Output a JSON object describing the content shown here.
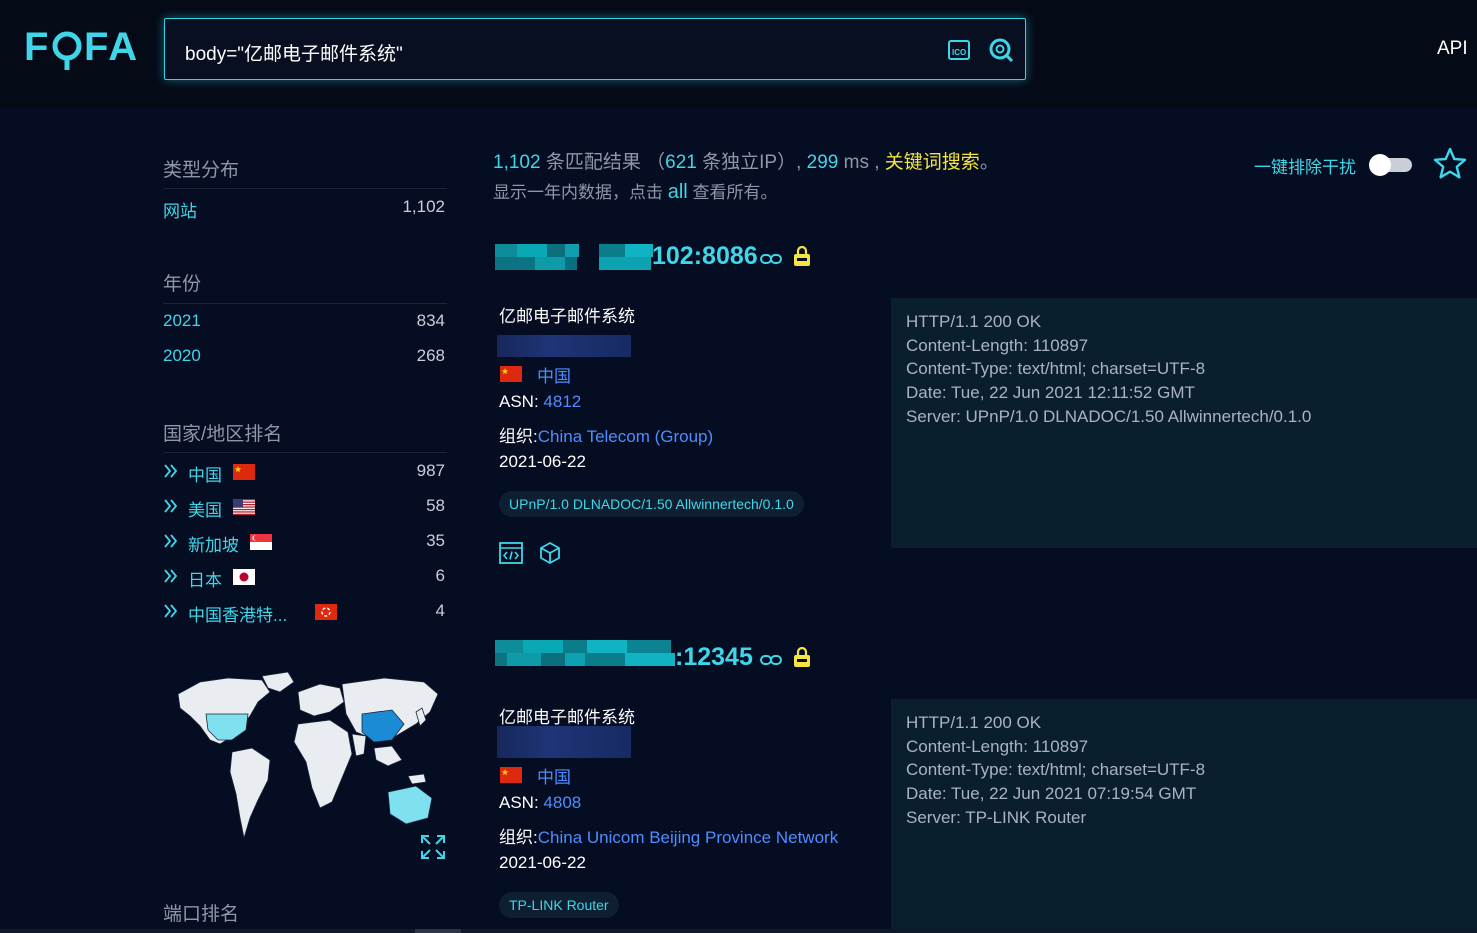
{
  "brand": {
    "logo_text": "FOFA"
  },
  "search": {
    "query": "body=\"亿邮电子邮件系统\"",
    "icons": [
      "ico-search-icon",
      "image-search-icon"
    ]
  },
  "header": {
    "api_label": "API"
  },
  "sidebar": {
    "type_section": {
      "title": "类型分布",
      "rows": [
        {
          "label": "网站",
          "count": "1,102"
        }
      ]
    },
    "year_section": {
      "title": "年份",
      "rows": [
        {
          "label": "2021",
          "count": "834"
        },
        {
          "label": "2020",
          "count": "268"
        }
      ]
    },
    "country_section": {
      "title": "国家/地区排名",
      "rows": [
        {
          "label": "中国",
          "count": "987",
          "flag": "cn-flag"
        },
        {
          "label": "美国",
          "count": "58",
          "flag": "us-flag"
        },
        {
          "label": "新加坡",
          "count": "35",
          "flag": "sg-flag"
        },
        {
          "label": "日本",
          "count": "6",
          "flag": "jp-flag"
        },
        {
          "label": "中国香港特...",
          "count": "4",
          "flag": "hk-flag"
        }
      ]
    },
    "port_section": {
      "title": "端口排名"
    }
  },
  "summary": {
    "total": "1,102",
    "total_suffix": "条匹配结果",
    "paren_open": "（",
    "unique_ip": "621",
    "unique_ip_suffix": "条独立IP）,",
    "time": "299",
    "time_unit": "ms ,",
    "mode": "关键词搜索",
    "mode_end": "。",
    "line2_prefix": "显示一年内数据，点击",
    "line2_link": "all",
    "line2_suffix": "查看所有。"
  },
  "controls": {
    "toggle_label": "一键排除干扰",
    "toggle_on": false
  },
  "results": [
    {
      "host_visible": "102:8086",
      "title": "亿邮电子邮件系统",
      "country": "中国",
      "asn_label": "ASN:",
      "asn": "4812",
      "org_label": "组织:",
      "org": "China Telecom (Group)",
      "date": "2021-06-22",
      "tag": "UPnP/1.0 DLNADOC/1.50 Allwinnertech/0.1.0",
      "banner": [
        "HTTP/1.1 200 OK",
        "Content-Length: 110897",
        "Content-Type: text/html; charset=UTF-8",
        "Date: Tue, 22 Jun 2021 12:11:52 GMT",
        "Server: UPnP/1.0 DLNADOC/1.50 Allwinnertech/0.1.0"
      ]
    },
    {
      "host_visible": ":12345",
      "title": "亿邮电子邮件系统",
      "country": "中国",
      "asn_label": "ASN:",
      "asn": "4808",
      "org_label": "组织:",
      "org": "China Unicom Beijing Province Network",
      "date": "2021-06-22",
      "tag": "TP-LINK Router",
      "banner": [
        "HTTP/1.1 200 OK",
        "Content-Length: 110897",
        "Content-Type: text/html; charset=UTF-8",
        "Date: Tue, 22 Jun 2021 07:19:54 GMT",
        "Server: TP-LINK Router"
      ]
    }
  ],
  "colors": {
    "accent": "#3fd6ea",
    "link": "#4f8dff",
    "highlight": "#f5e542",
    "background": "#040d21"
  }
}
